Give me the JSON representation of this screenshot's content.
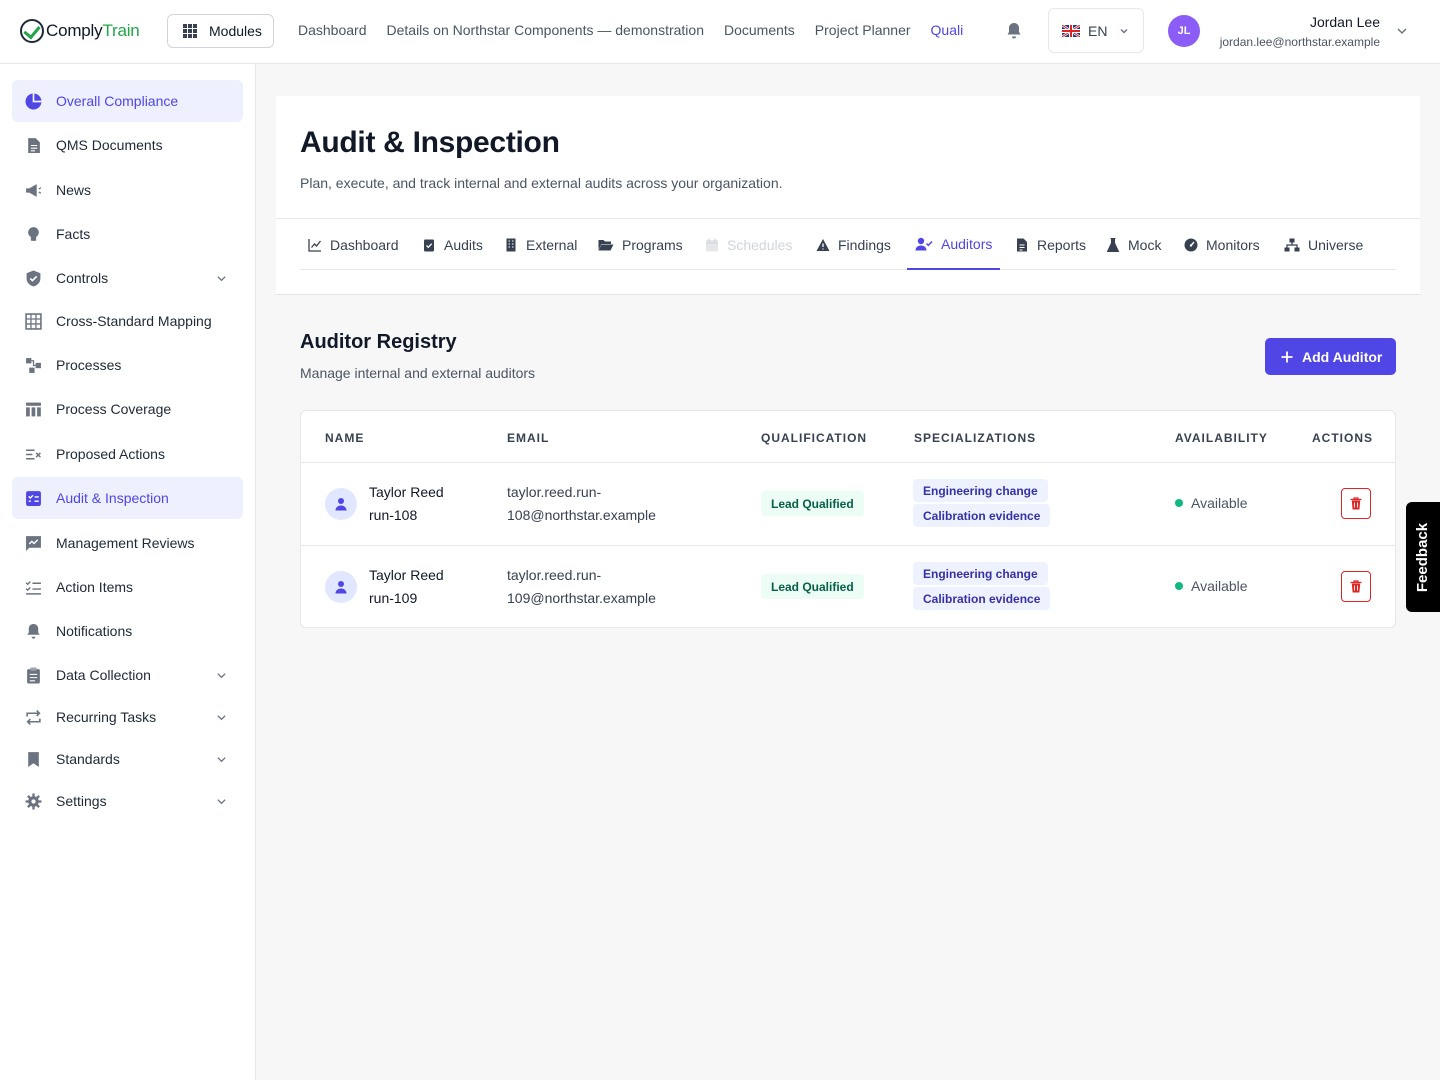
{
  "brand": {
    "name_a": "Comply",
    "name_b": "Train"
  },
  "topbar": {
    "modules_label": "Modules",
    "nav": [
      "Dashboard",
      "Details on Northstar Components — demonstration",
      "Documents",
      "Project Planner",
      "Quali"
    ],
    "language": "EN",
    "user": {
      "initials": "JL",
      "name": "Jordan Lee",
      "email": "jordan.lee@northstar.example"
    }
  },
  "sidebar": {
    "items": [
      {
        "label": "Overall Compliance",
        "icon": "pie-chart-icon",
        "active": true
      },
      {
        "label": "QMS Documents",
        "icon": "document-icon"
      },
      {
        "label": "News",
        "icon": "megaphone-icon"
      },
      {
        "label": "Facts",
        "icon": "lightbulb-icon"
      },
      {
        "label": "Controls",
        "icon": "shield-check-icon",
        "expandable": true
      },
      {
        "label": "Cross-Standard Mapping",
        "icon": "table-grid-icon"
      },
      {
        "label": "Processes",
        "icon": "flow-icon"
      },
      {
        "label": "Process Coverage",
        "icon": "columns-icon"
      },
      {
        "label": "Proposed Actions",
        "icon": "list-x-icon"
      },
      {
        "label": "Audit & Inspection",
        "icon": "clipboard-check-icon",
        "active": true
      },
      {
        "label": "Management Reviews",
        "icon": "chart-chat-icon"
      },
      {
        "label": "Action Items",
        "icon": "checklist-icon"
      },
      {
        "label": "Notifications",
        "icon": "bell-icon"
      },
      {
        "label": "Data Collection",
        "icon": "clipboard-icon",
        "expandable": true
      },
      {
        "label": "Recurring Tasks",
        "icon": "repeat-icon",
        "expandable": true
      },
      {
        "label": "Standards",
        "icon": "bookmark-icon",
        "expandable": true
      },
      {
        "label": "Settings",
        "icon": "gear-icon",
        "expandable": true
      }
    ]
  },
  "page": {
    "title": "Audit & Inspection",
    "subtitle": "Plan, execute, and track internal and external audits across your organization.",
    "tabs": [
      {
        "label": "Dashboard",
        "icon": "line-chart-icon"
      },
      {
        "label": "Audits",
        "icon": "clipboard-check-icon"
      },
      {
        "label": "External",
        "icon": "building-icon"
      },
      {
        "label": "Programs",
        "icon": "folder-open-icon"
      },
      {
        "label": "Schedules",
        "icon": "calendar-icon",
        "disabled": true
      },
      {
        "label": "Findings",
        "icon": "warning-icon"
      },
      {
        "label": "Auditors",
        "icon": "user-check-icon",
        "active": true
      },
      {
        "label": "Reports",
        "icon": "file-icon"
      },
      {
        "label": "Mock",
        "icon": "flask-icon"
      },
      {
        "label": "Monitors",
        "icon": "dashboard-gauge-icon"
      },
      {
        "label": "Universe",
        "icon": "sitemap-icon"
      }
    ]
  },
  "registry": {
    "title": "Auditor Registry",
    "subtitle": "Manage internal and external auditors",
    "add_button": "Add Auditor",
    "columns": [
      "NAME",
      "EMAIL",
      "QUALIFICATION",
      "SPECIALIZATIONS",
      "AVAILABILITY",
      "ACTIONS"
    ],
    "rows": [
      {
        "name_line1": "Taylor Reed",
        "name_line2": "run-108",
        "email_line1": "taylor.reed.run-",
        "email_line2": "108@northstar.example",
        "qualification": "Lead Qualified",
        "specializations": [
          "Engineering change",
          "Calibration evidence"
        ],
        "availability": "Available"
      },
      {
        "name_line1": "Taylor Reed",
        "name_line2": "run-109",
        "email_line1": "taylor.reed.run-",
        "email_line2": "109@northstar.example",
        "qualification": "Lead Qualified",
        "specializations": [
          "Engineering change",
          "Calibration evidence"
        ],
        "availability": "Available"
      }
    ]
  },
  "feedback_label": "Feedback",
  "colors": {
    "accent": "#4f46e5",
    "brand_green": "#22a547",
    "available": "#10b981",
    "danger": "#dc2626"
  }
}
